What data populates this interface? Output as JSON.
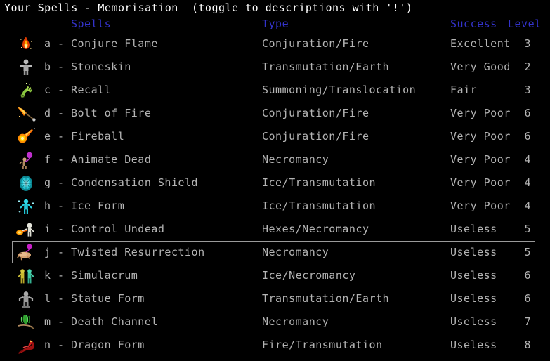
{
  "window": {
    "title": "Your Spells - Memorisation  (toggle to descriptions with '!')"
  },
  "colors": {
    "background": "#000000",
    "title_text": "#ffffff",
    "header_text": "#3333cc",
    "body_text": "#b4b4b4",
    "selection_border": "#9a9a9a"
  },
  "columns": {
    "spells": "Spells",
    "type": "Type",
    "success": "Success",
    "level": "Level"
  },
  "spells": [
    {
      "letter": "a",
      "separator": "-",
      "name": "Conjure Flame",
      "type": "Conjuration/Fire",
      "success": "Excellent",
      "level": "3",
      "icon": "flame-icon",
      "selected": false
    },
    {
      "letter": "b",
      "separator": "-",
      "name": "Stoneskin",
      "type": "Transmutation/Earth",
      "success": "Very Good",
      "level": "2",
      "icon": "stone-figure-icon",
      "selected": false
    },
    {
      "letter": "c",
      "separator": "-",
      "name": "Recall",
      "type": "Summoning/Translocation",
      "success": "Fair",
      "level": "3",
      "icon": "green-hand-icon",
      "selected": false
    },
    {
      "letter": "d",
      "separator": "-",
      "name": "Bolt of Fire",
      "type": "Conjuration/Fire",
      "success": "Very Poor",
      "level": "6",
      "icon": "fire-bolt-icon",
      "selected": false
    },
    {
      "letter": "e",
      "separator": "-",
      "name": "Fireball",
      "type": "Conjuration/Fire",
      "success": "Very Poor",
      "level": "6",
      "icon": "fireball-icon",
      "selected": false
    },
    {
      "letter": "f",
      "separator": "-",
      "name": "Animate Dead",
      "type": "Necromancy",
      "success": "Very Poor",
      "level": "4",
      "icon": "animate-dead-icon",
      "selected": false
    },
    {
      "letter": "g",
      "separator": "-",
      "name": "Condensation Shield",
      "type": "Ice/Transmutation",
      "success": "Very Poor",
      "level": "4",
      "icon": "ice-swirl-icon",
      "selected": false
    },
    {
      "letter": "h",
      "separator": "-",
      "name": "Ice Form",
      "type": "Ice/Transmutation",
      "success": "Very Poor",
      "level": "4",
      "icon": "ice-figure-icon",
      "selected": false
    },
    {
      "letter": "i",
      "separator": "-",
      "name": "Control Undead",
      "type": "Hexes/Necromancy",
      "success": "Useless",
      "level": "5",
      "icon": "skeleton-icon",
      "selected": false
    },
    {
      "letter": "j",
      "separator": "-",
      "name": "Twisted Resurrection",
      "type": "Necromancy",
      "success": "Useless",
      "level": "5",
      "icon": "twisted-corpse-icon",
      "selected": true
    },
    {
      "letter": "k",
      "separator": "-",
      "name": "Simulacrum",
      "type": "Ice/Necromancy",
      "success": "Useless",
      "level": "6",
      "icon": "twin-figures-icon",
      "selected": false
    },
    {
      "letter": "l",
      "separator": "-",
      "name": "Statue Form",
      "type": "Transmutation/Earth",
      "success": "Useless",
      "level": "6",
      "icon": "statue-icon",
      "selected": false
    },
    {
      "letter": "m",
      "separator": "-",
      "name": "Death Channel",
      "type": "Necromancy",
      "success": "Useless",
      "level": "7",
      "icon": "green-spirit-icon",
      "selected": false
    },
    {
      "letter": "n",
      "separator": "-",
      "name": "Dragon Form",
      "type": "Fire/Transmutation",
      "success": "Useless",
      "level": "8",
      "icon": "red-dragon-icon",
      "selected": false
    }
  ]
}
